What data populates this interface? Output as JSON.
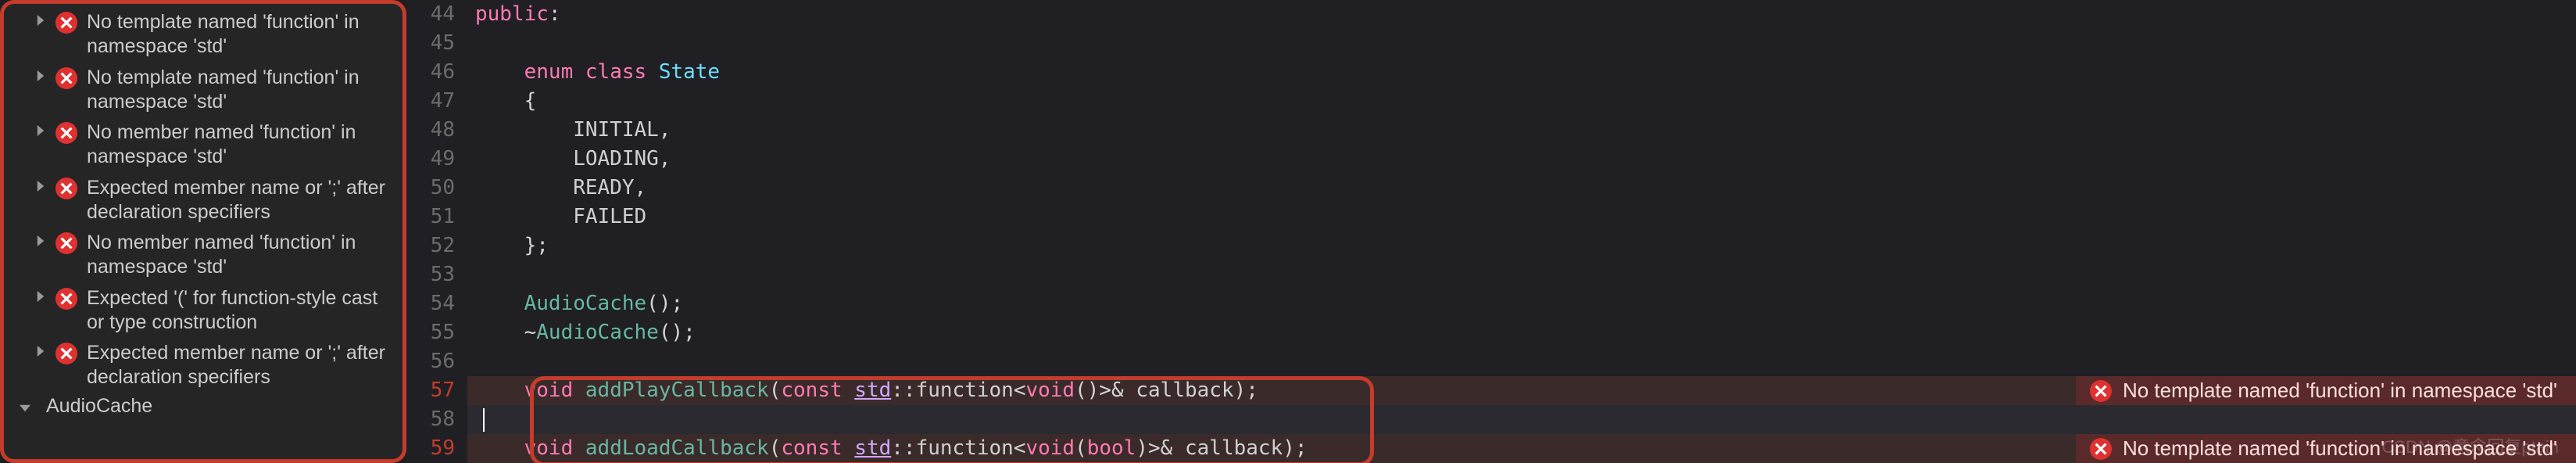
{
  "sidebar": {
    "issues": [
      {
        "text": "No template named 'function' in namespace 'std'"
      },
      {
        "text": "No template named 'function' in namespace 'std'"
      },
      {
        "text": "No member named 'function' in namespace 'std'"
      },
      {
        "text": "Expected member name or ';' after declaration specifiers"
      },
      {
        "text": "No member named 'function' in namespace 'std'"
      },
      {
        "text": "Expected '(' for function-style cast or type construction"
      },
      {
        "text": "Expected member name or ';' after declaration specifiers"
      }
    ],
    "bottom_item": "AudioCache"
  },
  "code": {
    "lines": [
      {
        "num": 44,
        "tokens": [
          {
            "t": "public",
            "c": "kw"
          },
          {
            "t": ":",
            "c": "punct"
          }
        ]
      },
      {
        "num": 45,
        "tokens": []
      },
      {
        "num": 46,
        "tokens": [
          {
            "t": "    ",
            "c": ""
          },
          {
            "t": "enum class ",
            "c": "kw"
          },
          {
            "t": "State",
            "c": "type"
          }
        ]
      },
      {
        "num": 47,
        "tokens": [
          {
            "t": "    {",
            "c": "punct"
          }
        ]
      },
      {
        "num": 48,
        "tokens": [
          {
            "t": "        INITIAL,",
            "c": "id"
          }
        ]
      },
      {
        "num": 49,
        "tokens": [
          {
            "t": "        LOADING,",
            "c": "id"
          }
        ]
      },
      {
        "num": 50,
        "tokens": [
          {
            "t": "        READY,",
            "c": "id"
          }
        ]
      },
      {
        "num": 51,
        "tokens": [
          {
            "t": "        FAILED",
            "c": "id"
          }
        ]
      },
      {
        "num": 52,
        "tokens": [
          {
            "t": "    };",
            "c": "punct"
          }
        ]
      },
      {
        "num": 53,
        "tokens": []
      },
      {
        "num": 54,
        "tokens": [
          {
            "t": "    ",
            "c": ""
          },
          {
            "t": "AudioCache",
            "c": "fn"
          },
          {
            "t": "();",
            "c": "punct"
          }
        ]
      },
      {
        "num": 55,
        "tokens": [
          {
            "t": "    ~",
            "c": "punct"
          },
          {
            "t": "AudioCache",
            "c": "fn"
          },
          {
            "t": "();",
            "c": "punct"
          }
        ]
      },
      {
        "num": 56,
        "tokens": []
      },
      {
        "num": 57,
        "hl": true,
        "tokens": [
          {
            "t": "    ",
            "c": ""
          },
          {
            "t": "void ",
            "c": "kw"
          },
          {
            "t": "addPlayCallback",
            "c": "fn"
          },
          {
            "t": "(",
            "c": "punct"
          },
          {
            "t": "const ",
            "c": "kw"
          },
          {
            "t": "std",
            "c": "namespace"
          },
          {
            "t": "::",
            "c": "punct"
          },
          {
            "t": "function",
            "c": "id"
          },
          {
            "t": "<",
            "c": "punct"
          },
          {
            "t": "void",
            "c": "kw"
          },
          {
            "t": "()>& ",
            "c": "punct"
          },
          {
            "t": "callback",
            "c": "id"
          },
          {
            "t": ");",
            "c": "punct"
          }
        ]
      },
      {
        "num": 58,
        "cursor": true,
        "tokens": []
      },
      {
        "num": 59,
        "hl": true,
        "tokens": [
          {
            "t": "    ",
            "c": ""
          },
          {
            "t": "void ",
            "c": "kw"
          },
          {
            "t": "addLoadCallback",
            "c": "fn"
          },
          {
            "t": "(",
            "c": "punct"
          },
          {
            "t": "const ",
            "c": "kw"
          },
          {
            "t": "std",
            "c": "namespace"
          },
          {
            "t": "::",
            "c": "punct"
          },
          {
            "t": "function",
            "c": "id"
          },
          {
            "t": "<",
            "c": "punct"
          },
          {
            "t": "void",
            "c": "kw"
          },
          {
            "t": "(",
            "c": "punct"
          },
          {
            "t": "bool",
            "c": "kw"
          },
          {
            "t": ")>& ",
            "c": "punct"
          },
          {
            "t": "callback",
            "c": "id"
          },
          {
            "t": ");",
            "c": "punct"
          }
        ]
      }
    ]
  },
  "inline_errors": [
    {
      "line": 57,
      "text": "No template named 'function' in namespace 'std'"
    },
    {
      "line": 59,
      "text": "No template named 'function' in namespace 'std'"
    }
  ],
  "watermark": "CSDN @意念回复ptain"
}
